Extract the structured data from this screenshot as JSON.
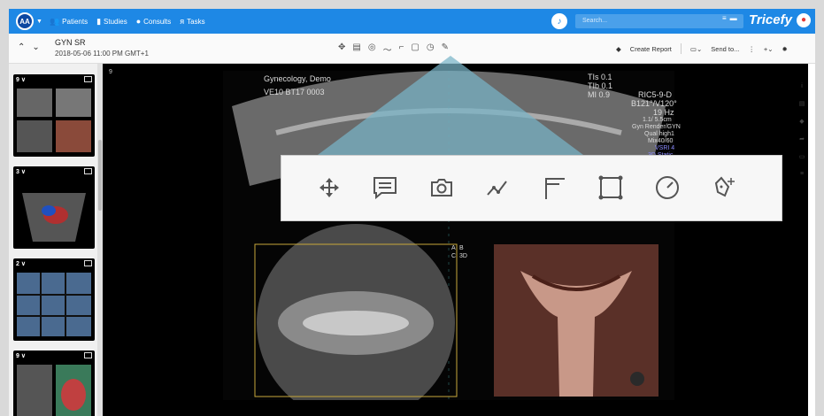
{
  "topnav": {
    "avatar_initials": "AA",
    "items": [
      {
        "icon": "people-icon",
        "label": "Patients"
      },
      {
        "icon": "folder-icon",
        "label": "Studies"
      },
      {
        "icon": "chat-icon",
        "label": "Consults"
      },
      {
        "icon": "tasks-icon",
        "label": "Tasks"
      }
    ],
    "search_placeholder": "Search...",
    "brand": "Tricefy"
  },
  "subheader": {
    "study_title": "GYN SR",
    "study_date": "2018-05-06 11:00 PM GMT+1",
    "create_report": "Create Report",
    "send_to": "Send to..."
  },
  "thumbnails": [
    {
      "label": "9 ∨"
    },
    {
      "label": "3 ∨"
    },
    {
      "label": "2 ∨"
    },
    {
      "label": "9 ∨"
    }
  ],
  "viewer": {
    "image_number": "9",
    "overlay": {
      "patient": "Gynecology, Demo",
      "device": "VE10 BT17 0003",
      "tis": "TIs  0.1",
      "tib": "TIb  0.1",
      "mi": "MI   0.9",
      "probe": "RIC5-9-D",
      "angle": "B121°/V120°",
      "freq": "19 Hz",
      "depth": "1.1/ 5.5cm",
      "mode": "Gyn Render/GYN",
      "qual": "Qual high1",
      "mix": "Mix40/60",
      "vsri": "VSRI 4",
      "static": "3D Static",
      "view_a": "A",
      "view_b": "B",
      "view_c": "C",
      "view_3d": "3D"
    }
  },
  "toolbar_popup": {
    "tools": [
      "move-icon",
      "comment-icon",
      "camera-icon",
      "polyline-icon",
      "angle-icon",
      "rectangle-icon",
      "gauge-icon",
      "pen-add-icon"
    ]
  },
  "colors": {
    "nav": "#1e88e5",
    "popup_tri": "#78b4c8"
  }
}
